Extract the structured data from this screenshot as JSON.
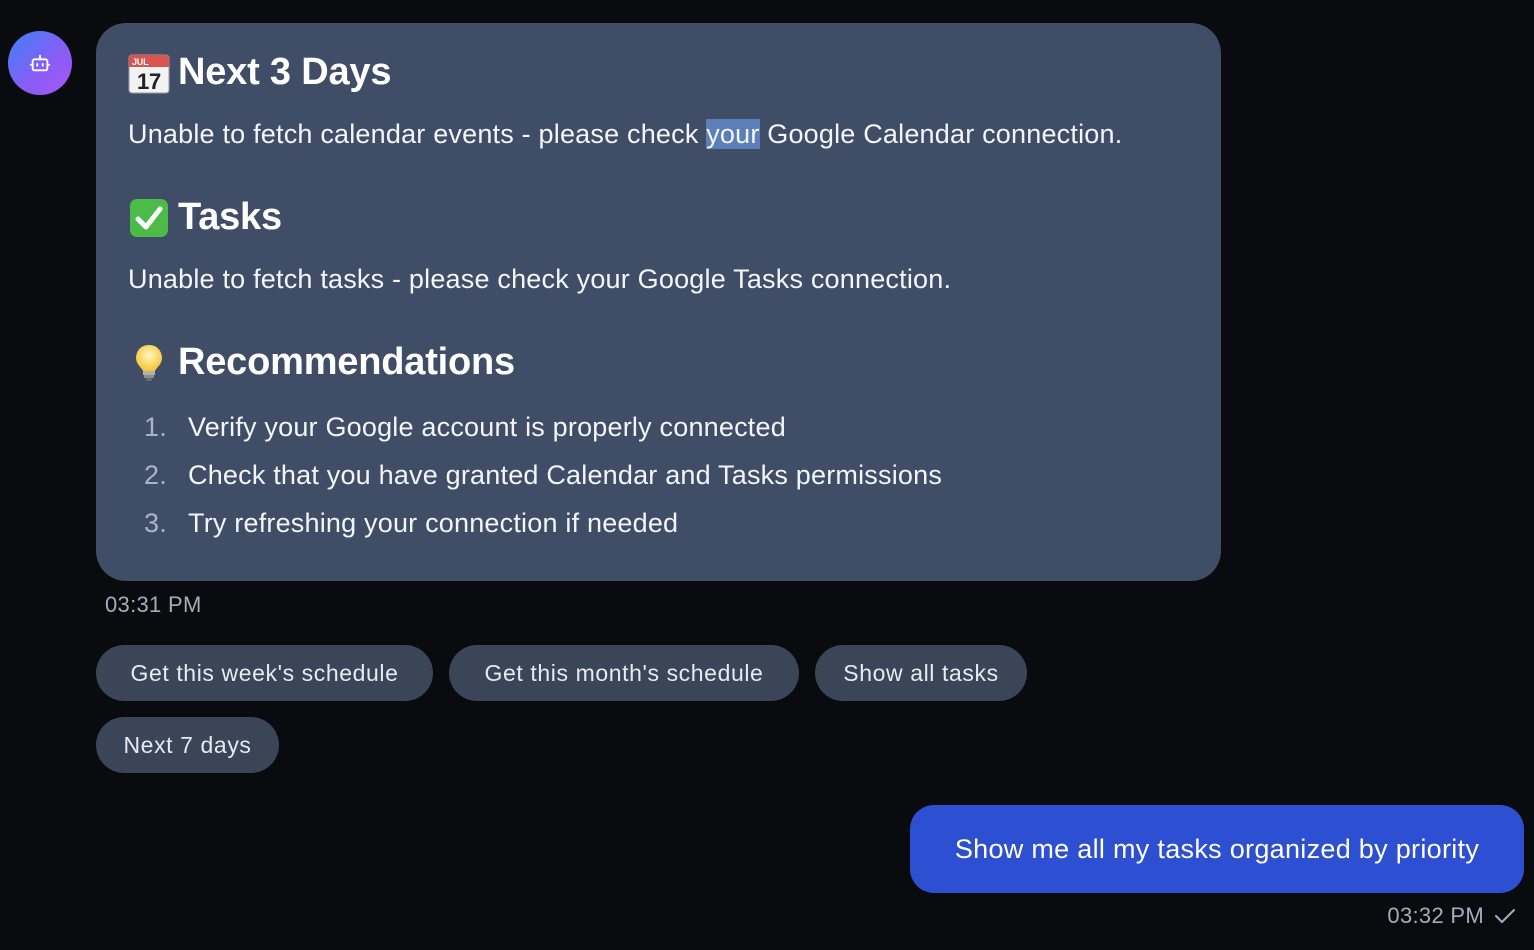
{
  "assistant": {
    "avatar_icon": "robot-icon",
    "message": {
      "sections": [
        {
          "emoji_icon": "calendar-icon",
          "heading": "Next 3 Days",
          "body_before": "Unable to fetch calendar events - please check ",
          "body_highlight": "your",
          "body_after": " Google Calendar connection."
        },
        {
          "emoji_icon": "check-mark-button-icon",
          "heading": "Tasks",
          "body": "Unable to fetch tasks - please check your Google Tasks connection."
        },
        {
          "emoji_icon": "light-bulb-icon",
          "heading": "Recommendations"
        }
      ],
      "recommendations": [
        {
          "num": "1.",
          "text": "Verify your Google account is properly connected"
        },
        {
          "num": "2.",
          "text": "Check that you have granted Calendar and Tasks permissions"
        },
        {
          "num": "3.",
          "text": "Try refreshing your connection if needed"
        }
      ],
      "calendar_month": "JUL",
      "calendar_day": "17"
    },
    "timestamp": "03:31 PM"
  },
  "suggestions": [
    "Get this week's schedule",
    "Get this month's schedule",
    "Show all tasks",
    "Next 7 days"
  ],
  "user": {
    "message": "Show me all my tasks organized by priority",
    "timestamp": "03:32 PM",
    "status_icon": "checkmark-icon"
  },
  "colors": {
    "background": "#0a0b0e",
    "assistant_bubble": "#3f4d66",
    "user_bubble": "#2d4fd1",
    "chip": "#3b4558",
    "selection_highlight": "#5b7fb8"
  }
}
